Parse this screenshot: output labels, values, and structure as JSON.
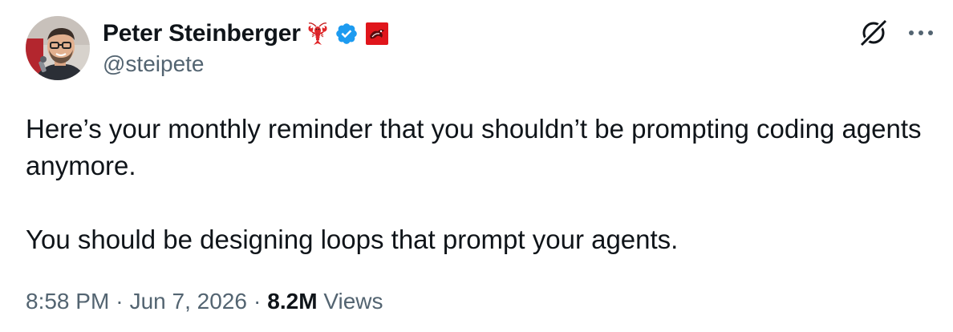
{
  "author": {
    "display_name": "Peter Steinberger",
    "handle": "@steipete",
    "name_emoji": "lobster",
    "verified_color": "#1d9bf0",
    "affiliation_badge": "red-affiliate-badge"
  },
  "tweet": {
    "paragraph_1": "Here’s your monthly reminder that you shouldn’t be prompting coding agents anymore.",
    "paragraph_2": "You should be designing loops that prompt your agents."
  },
  "meta": {
    "time": "8:58 PM",
    "separator": "·",
    "date": "Jun 7, 2026",
    "views_count": "8.2M",
    "views_label": "Views"
  },
  "icons": {
    "grok": "grok-icon",
    "more": "more-options-icon"
  },
  "colors": {
    "text_primary": "#0f1419",
    "text_secondary": "#536471",
    "verified": "#1d9bf0",
    "badge_red": "#e0151b"
  }
}
